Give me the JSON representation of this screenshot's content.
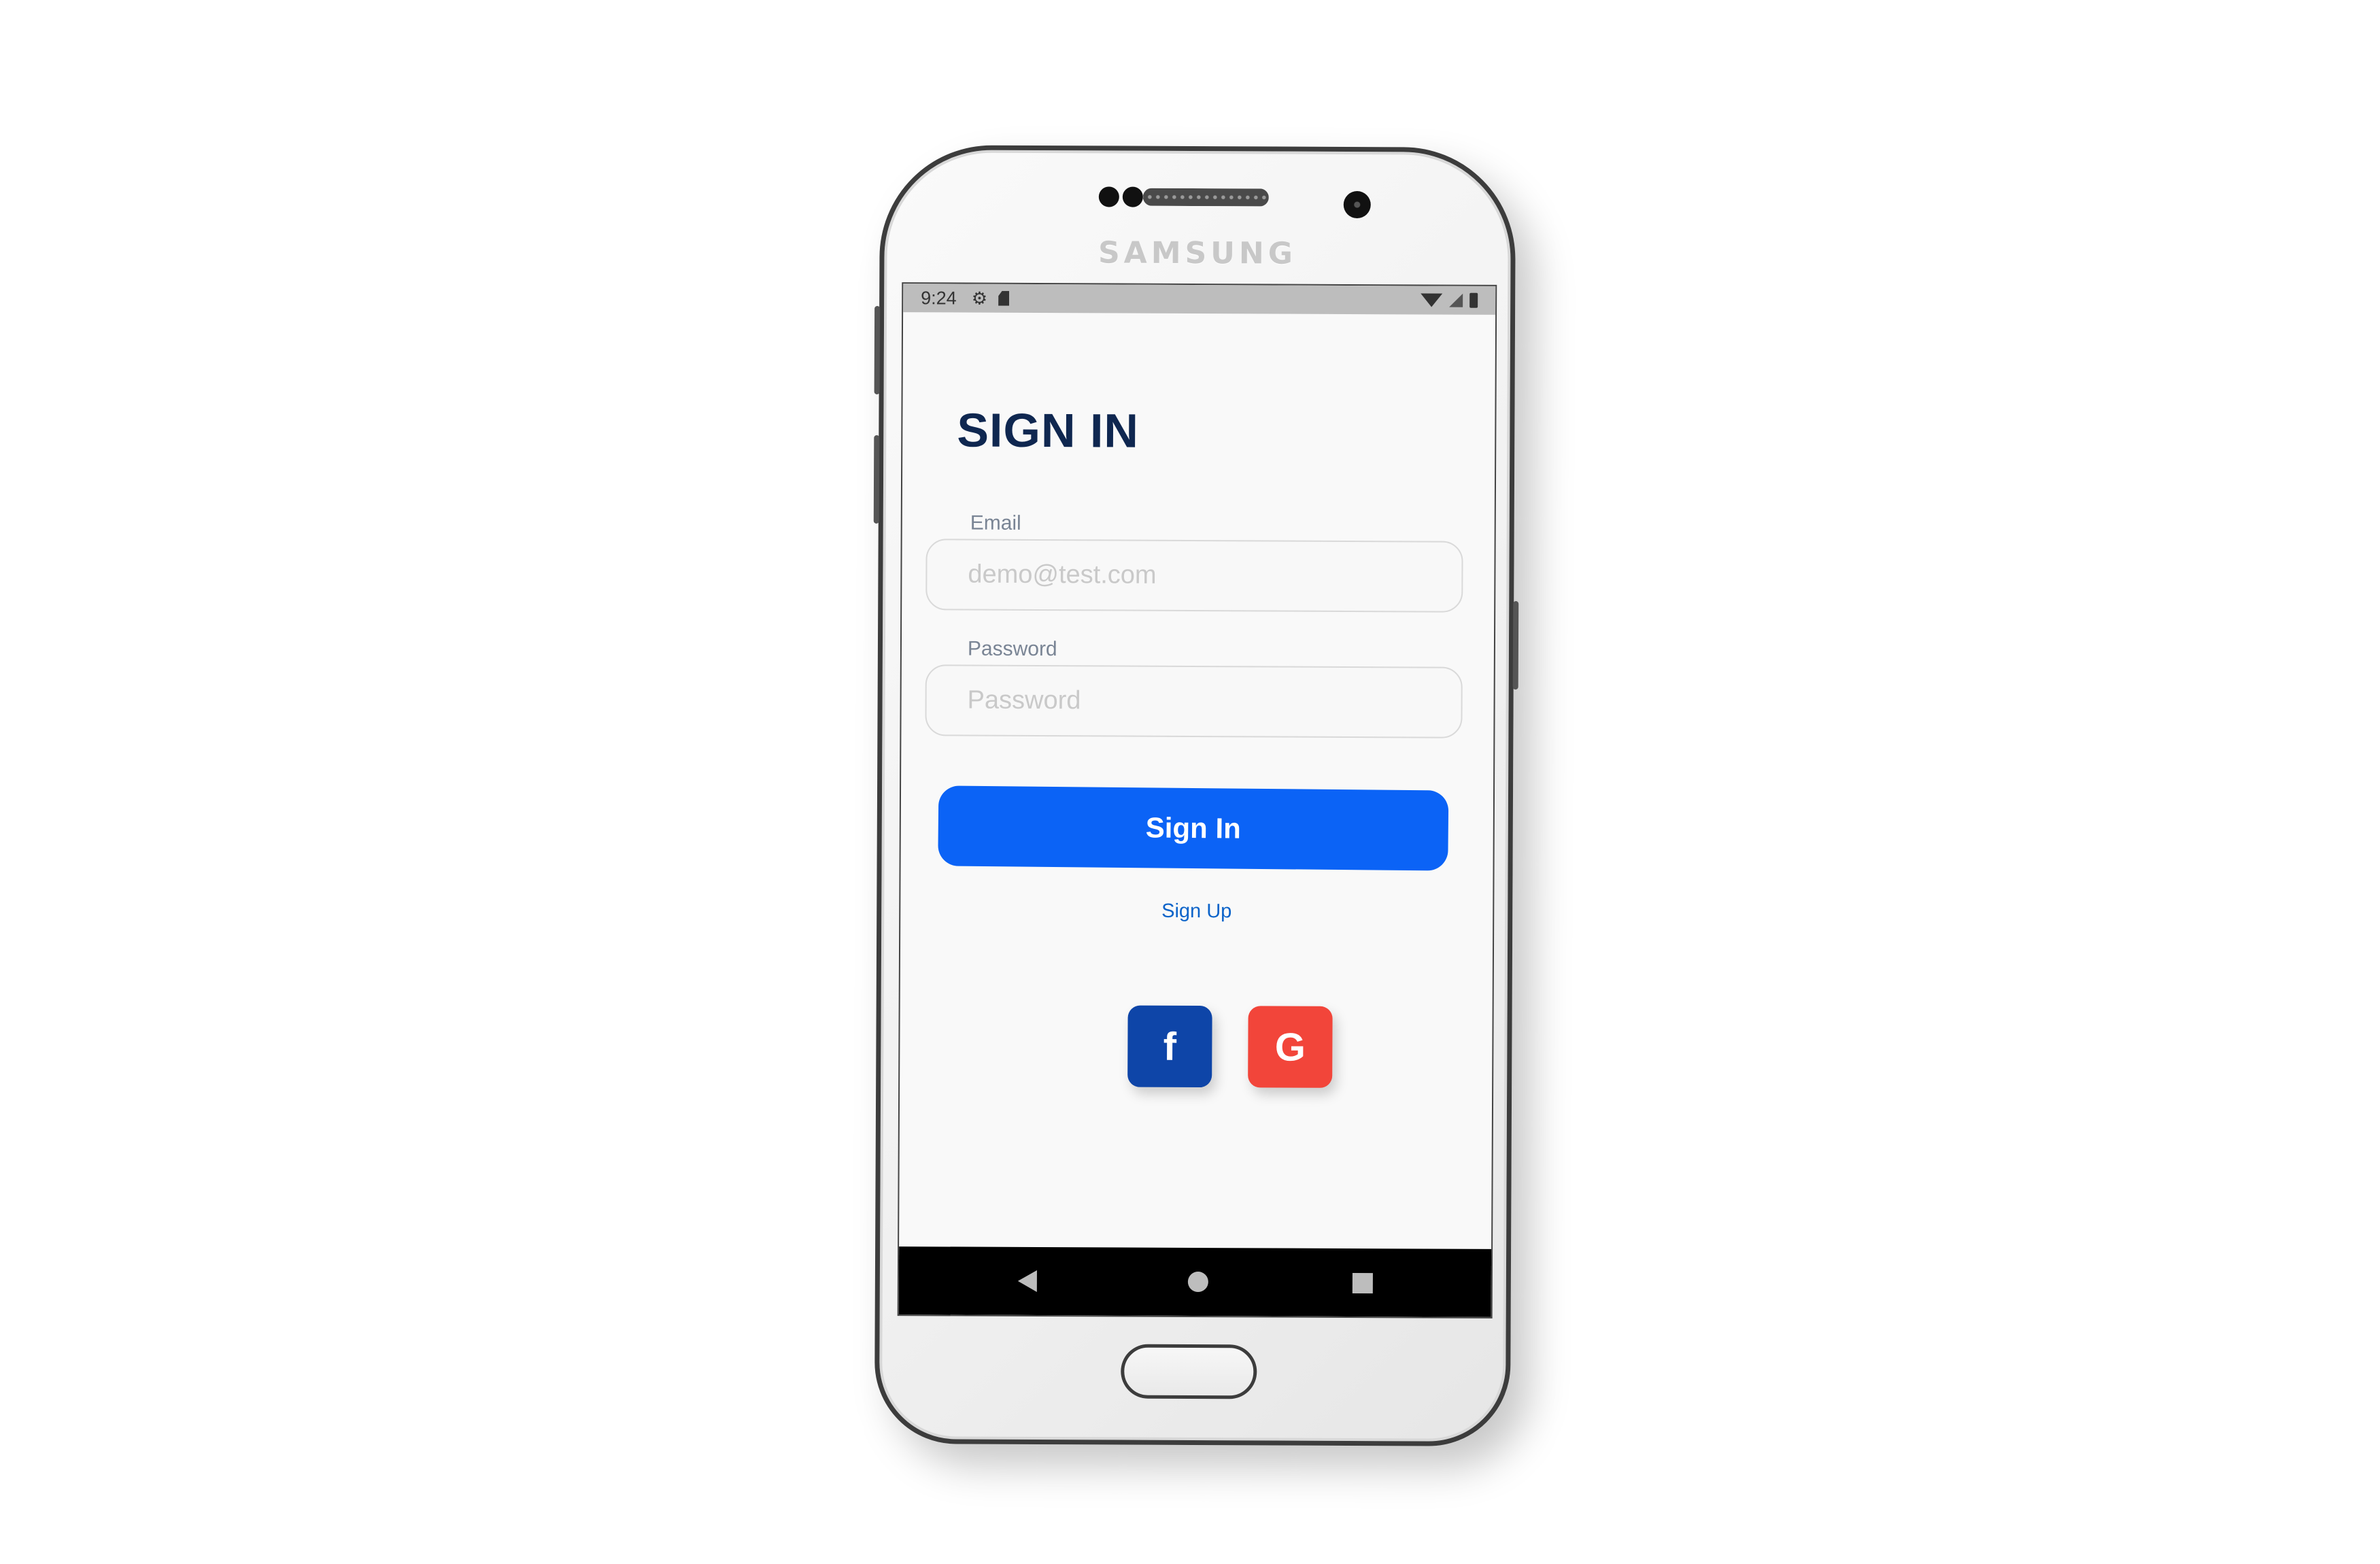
{
  "device": {
    "brand": "SAMSUNG"
  },
  "status_bar": {
    "time": "9:24",
    "icons": [
      "gear-icon",
      "sd-card-icon",
      "wifi-icon",
      "cell-signal-icon",
      "battery-icon"
    ]
  },
  "page": {
    "title": "SIGN IN"
  },
  "form": {
    "email_label": "Email",
    "email_placeholder": "demo@test.com",
    "email_value": "",
    "password_label": "Password",
    "password_placeholder": "Password",
    "password_value": ""
  },
  "actions": {
    "sign_in_label": "Sign In",
    "sign_up_label": "Sign Up"
  },
  "social": {
    "facebook_label": "f",
    "google_label": "G",
    "facebook_color": "#0e45a8",
    "google_color": "#f2453a"
  },
  "colors": {
    "primary": "#0b63f6",
    "title": "#0f2750",
    "link": "#0b63c9"
  },
  "nav": {
    "icons": [
      "back-icon",
      "home-icon",
      "recents-icon"
    ]
  }
}
